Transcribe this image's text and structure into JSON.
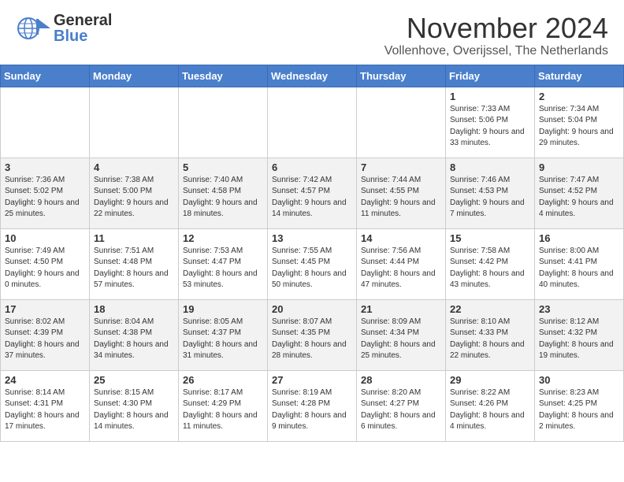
{
  "header": {
    "logo_general": "General",
    "logo_blue": "Blue",
    "month": "November 2024",
    "location": "Vollenhove, Overijssel, The Netherlands"
  },
  "weekdays": [
    "Sunday",
    "Monday",
    "Tuesday",
    "Wednesday",
    "Thursday",
    "Friday",
    "Saturday"
  ],
  "weeks": [
    [
      {
        "day": "",
        "info": ""
      },
      {
        "day": "",
        "info": ""
      },
      {
        "day": "",
        "info": ""
      },
      {
        "day": "",
        "info": ""
      },
      {
        "day": "",
        "info": ""
      },
      {
        "day": "1",
        "info": "Sunrise: 7:33 AM\nSunset: 5:06 PM\nDaylight: 9 hours and 33 minutes."
      },
      {
        "day": "2",
        "info": "Sunrise: 7:34 AM\nSunset: 5:04 PM\nDaylight: 9 hours and 29 minutes."
      }
    ],
    [
      {
        "day": "3",
        "info": "Sunrise: 7:36 AM\nSunset: 5:02 PM\nDaylight: 9 hours and 25 minutes."
      },
      {
        "day": "4",
        "info": "Sunrise: 7:38 AM\nSunset: 5:00 PM\nDaylight: 9 hours and 22 minutes."
      },
      {
        "day": "5",
        "info": "Sunrise: 7:40 AM\nSunset: 4:58 PM\nDaylight: 9 hours and 18 minutes."
      },
      {
        "day": "6",
        "info": "Sunrise: 7:42 AM\nSunset: 4:57 PM\nDaylight: 9 hours and 14 minutes."
      },
      {
        "day": "7",
        "info": "Sunrise: 7:44 AM\nSunset: 4:55 PM\nDaylight: 9 hours and 11 minutes."
      },
      {
        "day": "8",
        "info": "Sunrise: 7:46 AM\nSunset: 4:53 PM\nDaylight: 9 hours and 7 minutes."
      },
      {
        "day": "9",
        "info": "Sunrise: 7:47 AM\nSunset: 4:52 PM\nDaylight: 9 hours and 4 minutes."
      }
    ],
    [
      {
        "day": "10",
        "info": "Sunrise: 7:49 AM\nSunset: 4:50 PM\nDaylight: 9 hours and 0 minutes."
      },
      {
        "day": "11",
        "info": "Sunrise: 7:51 AM\nSunset: 4:48 PM\nDaylight: 8 hours and 57 minutes."
      },
      {
        "day": "12",
        "info": "Sunrise: 7:53 AM\nSunset: 4:47 PM\nDaylight: 8 hours and 53 minutes."
      },
      {
        "day": "13",
        "info": "Sunrise: 7:55 AM\nSunset: 4:45 PM\nDaylight: 8 hours and 50 minutes."
      },
      {
        "day": "14",
        "info": "Sunrise: 7:56 AM\nSunset: 4:44 PM\nDaylight: 8 hours and 47 minutes."
      },
      {
        "day": "15",
        "info": "Sunrise: 7:58 AM\nSunset: 4:42 PM\nDaylight: 8 hours and 43 minutes."
      },
      {
        "day": "16",
        "info": "Sunrise: 8:00 AM\nSunset: 4:41 PM\nDaylight: 8 hours and 40 minutes."
      }
    ],
    [
      {
        "day": "17",
        "info": "Sunrise: 8:02 AM\nSunset: 4:39 PM\nDaylight: 8 hours and 37 minutes."
      },
      {
        "day": "18",
        "info": "Sunrise: 8:04 AM\nSunset: 4:38 PM\nDaylight: 8 hours and 34 minutes."
      },
      {
        "day": "19",
        "info": "Sunrise: 8:05 AM\nSunset: 4:37 PM\nDaylight: 8 hours and 31 minutes."
      },
      {
        "day": "20",
        "info": "Sunrise: 8:07 AM\nSunset: 4:35 PM\nDaylight: 8 hours and 28 minutes."
      },
      {
        "day": "21",
        "info": "Sunrise: 8:09 AM\nSunset: 4:34 PM\nDaylight: 8 hours and 25 minutes."
      },
      {
        "day": "22",
        "info": "Sunrise: 8:10 AM\nSunset: 4:33 PM\nDaylight: 8 hours and 22 minutes."
      },
      {
        "day": "23",
        "info": "Sunrise: 8:12 AM\nSunset: 4:32 PM\nDaylight: 8 hours and 19 minutes."
      }
    ],
    [
      {
        "day": "24",
        "info": "Sunrise: 8:14 AM\nSunset: 4:31 PM\nDaylight: 8 hours and 17 minutes."
      },
      {
        "day": "25",
        "info": "Sunrise: 8:15 AM\nSunset: 4:30 PM\nDaylight: 8 hours and 14 minutes."
      },
      {
        "day": "26",
        "info": "Sunrise: 8:17 AM\nSunset: 4:29 PM\nDaylight: 8 hours and 11 minutes."
      },
      {
        "day": "27",
        "info": "Sunrise: 8:19 AM\nSunset: 4:28 PM\nDaylight: 8 hours and 9 minutes."
      },
      {
        "day": "28",
        "info": "Sunrise: 8:20 AM\nSunset: 4:27 PM\nDaylight: 8 hours and 6 minutes."
      },
      {
        "day": "29",
        "info": "Sunrise: 8:22 AM\nSunset: 4:26 PM\nDaylight: 8 hours and 4 minutes."
      },
      {
        "day": "30",
        "info": "Sunrise: 8:23 AM\nSunset: 4:25 PM\nDaylight: 8 hours and 2 minutes."
      }
    ]
  ]
}
